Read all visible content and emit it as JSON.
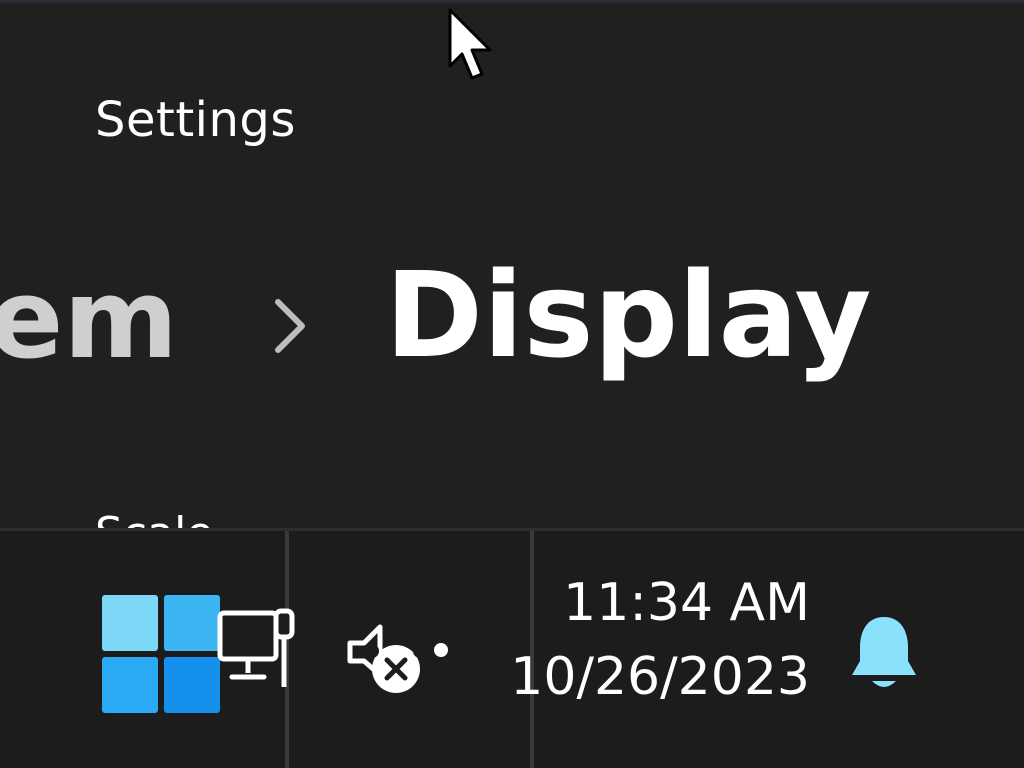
{
  "window": {
    "title": "Settings",
    "breadcrumb": {
      "parent": "em",
      "current": "Display"
    },
    "partial_heading": "Scale"
  },
  "taskbar": {
    "start_icon": "windows-logo-icon",
    "tray_icons": [
      "network-wired-icon",
      "volume-muted-icon",
      "notification-bell-icon"
    ],
    "clock": {
      "time": "11:34 AM",
      "date": "10/26/2023"
    }
  },
  "colors": {
    "background": "#202020",
    "taskbar": "#1c1c1c",
    "text_primary": "#ffffff",
    "text_secondary": "#cfcfcf",
    "accent_light": "#7fdcf7",
    "accent": "#1aa1f0",
    "accent_dark": "#0f7fd8"
  }
}
